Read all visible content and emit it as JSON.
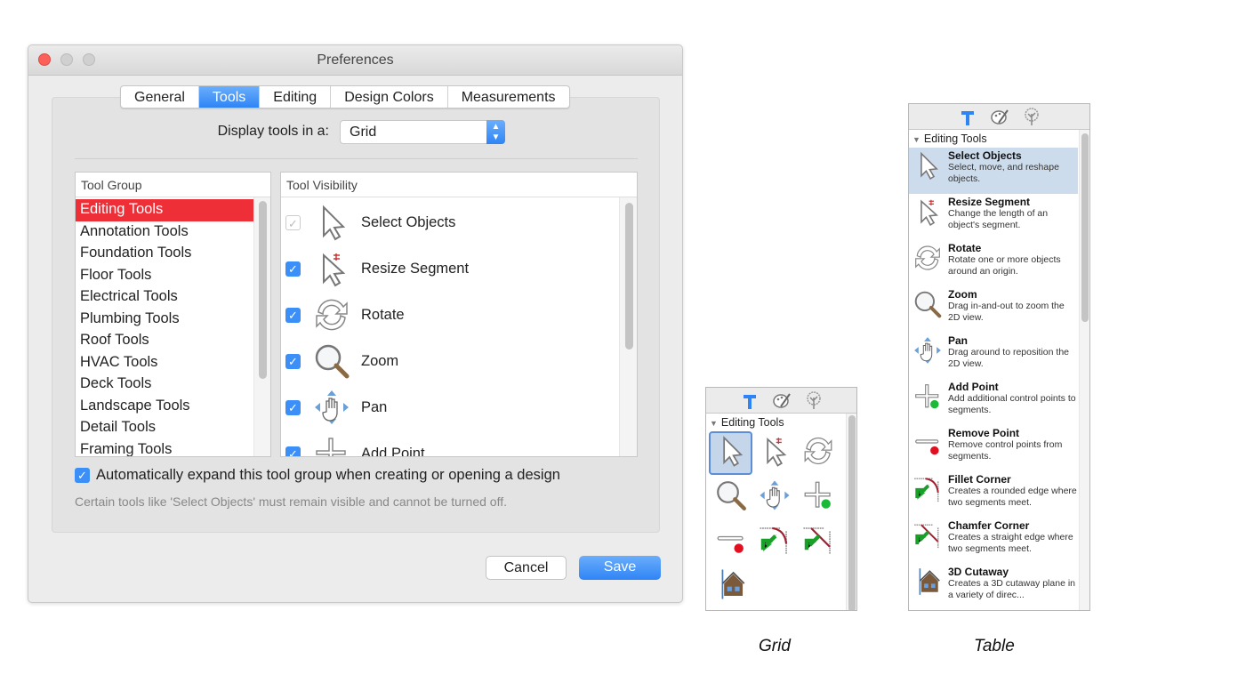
{
  "window": {
    "title": "Preferences"
  },
  "tabs": [
    {
      "label": "General"
    },
    {
      "label": "Tools",
      "active": true
    },
    {
      "label": "Editing"
    },
    {
      "label": "Design Colors"
    },
    {
      "label": "Measurements"
    }
  ],
  "display": {
    "label": "Display tools in a:",
    "value": "Grid"
  },
  "tool_group": {
    "header": "Tool Group",
    "items": [
      "Editing Tools",
      "Annotation Tools",
      "Foundation Tools",
      "Floor Tools",
      "Electrical Tools",
      "Plumbing Tools",
      "Roof Tools",
      "HVAC Tools",
      "Deck Tools",
      "Landscape Tools",
      "Detail Tools",
      "Framing Tools"
    ],
    "selected": "Editing Tools"
  },
  "tool_visibility": {
    "header": "Tool Visibility",
    "items": [
      {
        "label": "Select Objects",
        "icon": "select-icon",
        "checked": true,
        "disabled": true
      },
      {
        "label": "Resize Segment",
        "icon": "resize-icon",
        "checked": true
      },
      {
        "label": "Rotate",
        "icon": "rotate-icon",
        "checked": true
      },
      {
        "label": "Zoom",
        "icon": "zoom-icon",
        "checked": true
      },
      {
        "label": "Pan",
        "icon": "pan-icon",
        "checked": true
      },
      {
        "label": "Add Point",
        "icon": "add-point-icon",
        "checked": true
      }
    ]
  },
  "auto_expand": {
    "label": "Automatically expand this tool group when creating or opening a design",
    "checked": true
  },
  "note": "Certain tools like 'Select Objects' must remain visible and cannot be turned off.",
  "buttons": {
    "cancel": "Cancel",
    "save": "Save"
  },
  "colors": {
    "accent": "#2f84f5",
    "selection": "#ee2f38"
  },
  "grid_panel": {
    "caption": "Grid",
    "header": "Editing Tools",
    "tab_icons": [
      "hammer-icon",
      "palette-icon",
      "tree-icon"
    ],
    "icons": [
      "select-icon",
      "resize-icon",
      "rotate-icon",
      "zoom-icon",
      "pan-icon",
      "add-point-icon",
      "remove-point-icon",
      "fillet-icon",
      "chamfer-icon",
      "cutaway-icon"
    ]
  },
  "table_panel": {
    "caption": "Table",
    "header": "Editing Tools",
    "tab_icons": [
      "hammer-icon",
      "palette-icon",
      "tree-icon"
    ],
    "items": [
      {
        "name": "Select Objects",
        "desc": "Select, move, and reshape objects.",
        "icon": "select-icon"
      },
      {
        "name": "Resize Segment",
        "desc": "Change the length of an object's segment.",
        "icon": "resize-icon"
      },
      {
        "name": "Rotate",
        "desc": "Rotate one or more objects around an origin.",
        "icon": "rotate-icon"
      },
      {
        "name": "Zoom",
        "desc": "Drag in-and-out to zoom the 2D view.",
        "icon": "zoom-icon"
      },
      {
        "name": "Pan",
        "desc": "Drag around to reposition the 2D view.",
        "icon": "pan-icon"
      },
      {
        "name": "Add Point",
        "desc": "Add additional control points to segments.",
        "icon": "add-point-icon"
      },
      {
        "name": "Remove Point",
        "desc": "Remove control points from segments.",
        "icon": "remove-point-icon"
      },
      {
        "name": "Fillet Corner",
        "desc": "Creates a rounded edge where two segments meet.",
        "icon": "fillet-icon"
      },
      {
        "name": "Chamfer Corner",
        "desc": "Creates a straight edge where two segments meet.",
        "icon": "chamfer-icon"
      },
      {
        "name": "3D Cutaway",
        "desc": "Creates a 3D cutaway plane in a variety of direc...",
        "icon": "cutaway-icon"
      }
    ]
  }
}
